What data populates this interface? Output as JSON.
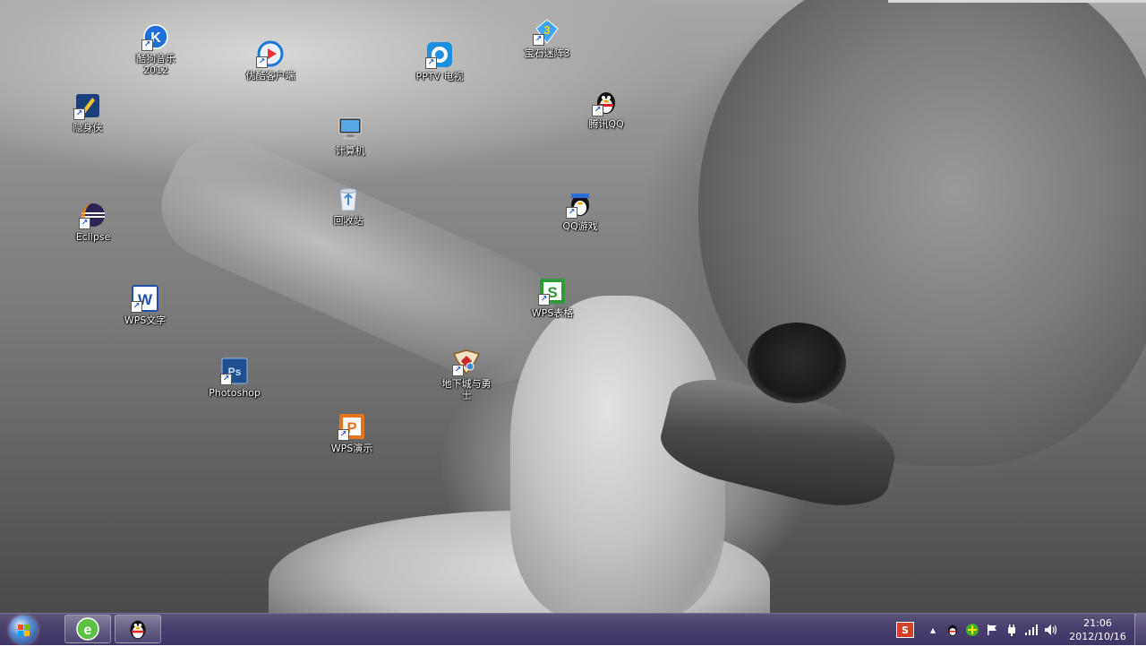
{
  "desktop": {
    "icons": [
      {
        "id": "kugou",
        "label": "酷狗音乐\n2012",
        "icon": "kugou-music-icon"
      },
      {
        "id": "youku",
        "label": "优酷客户端",
        "icon": "youku-client-icon"
      },
      {
        "id": "pptv",
        "label": "PPTV 电视",
        "icon": "pptv-icon"
      },
      {
        "id": "baoshi",
        "label": "宝石迷阵3",
        "icon": "bejeweled-icon"
      },
      {
        "id": "yinshenxia",
        "label": "隐身侠",
        "icon": "yinshenxia-icon"
      },
      {
        "id": "qq",
        "label": "腾讯QQ",
        "icon": "qq-penguin-icon"
      },
      {
        "id": "computer",
        "label": "计算机",
        "icon": "computer-icon"
      },
      {
        "id": "recycle",
        "label": "回收站",
        "icon": "recycle-bin-icon"
      },
      {
        "id": "eclipse",
        "label": "Eclipse",
        "icon": "eclipse-icon"
      },
      {
        "id": "qqgame",
        "label": "QQ游戏",
        "icon": "qq-game-icon"
      },
      {
        "id": "wps-writer",
        "label": "WPS文字",
        "icon": "wps-writer-icon"
      },
      {
        "id": "wps-sheet",
        "label": "WPS表格",
        "icon": "wps-spreadsheet-icon"
      },
      {
        "id": "photoshop",
        "label": "Photoshop",
        "icon": "photoshop-icon"
      },
      {
        "id": "dnf",
        "label": "地下城与勇士",
        "icon": "dnf-game-icon"
      },
      {
        "id": "wps-present",
        "label": "WPS演示",
        "icon": "wps-presentation-icon"
      }
    ]
  },
  "taskbar": {
    "start_icon": "windows-start-orb",
    "pinned": [
      {
        "id": "browser",
        "icon": "green-e-browser-icon"
      },
      {
        "id": "qq",
        "icon": "qq-penguin-icon"
      }
    ],
    "tray": {
      "ime_label": "S",
      "icons": [
        "ime-sogou-icon",
        "chevron-up-icon",
        "qq-tray-icon",
        "green-plus-icon",
        "action-center-flag-icon",
        "power-plug-icon",
        "network-signal-icon",
        "volume-icon"
      ]
    },
    "clock": {
      "time": "21:06",
      "date": "2012/10/16"
    }
  },
  "colors": {
    "taskbar": "#4a3f6e",
    "label_text": "#ffffff"
  }
}
